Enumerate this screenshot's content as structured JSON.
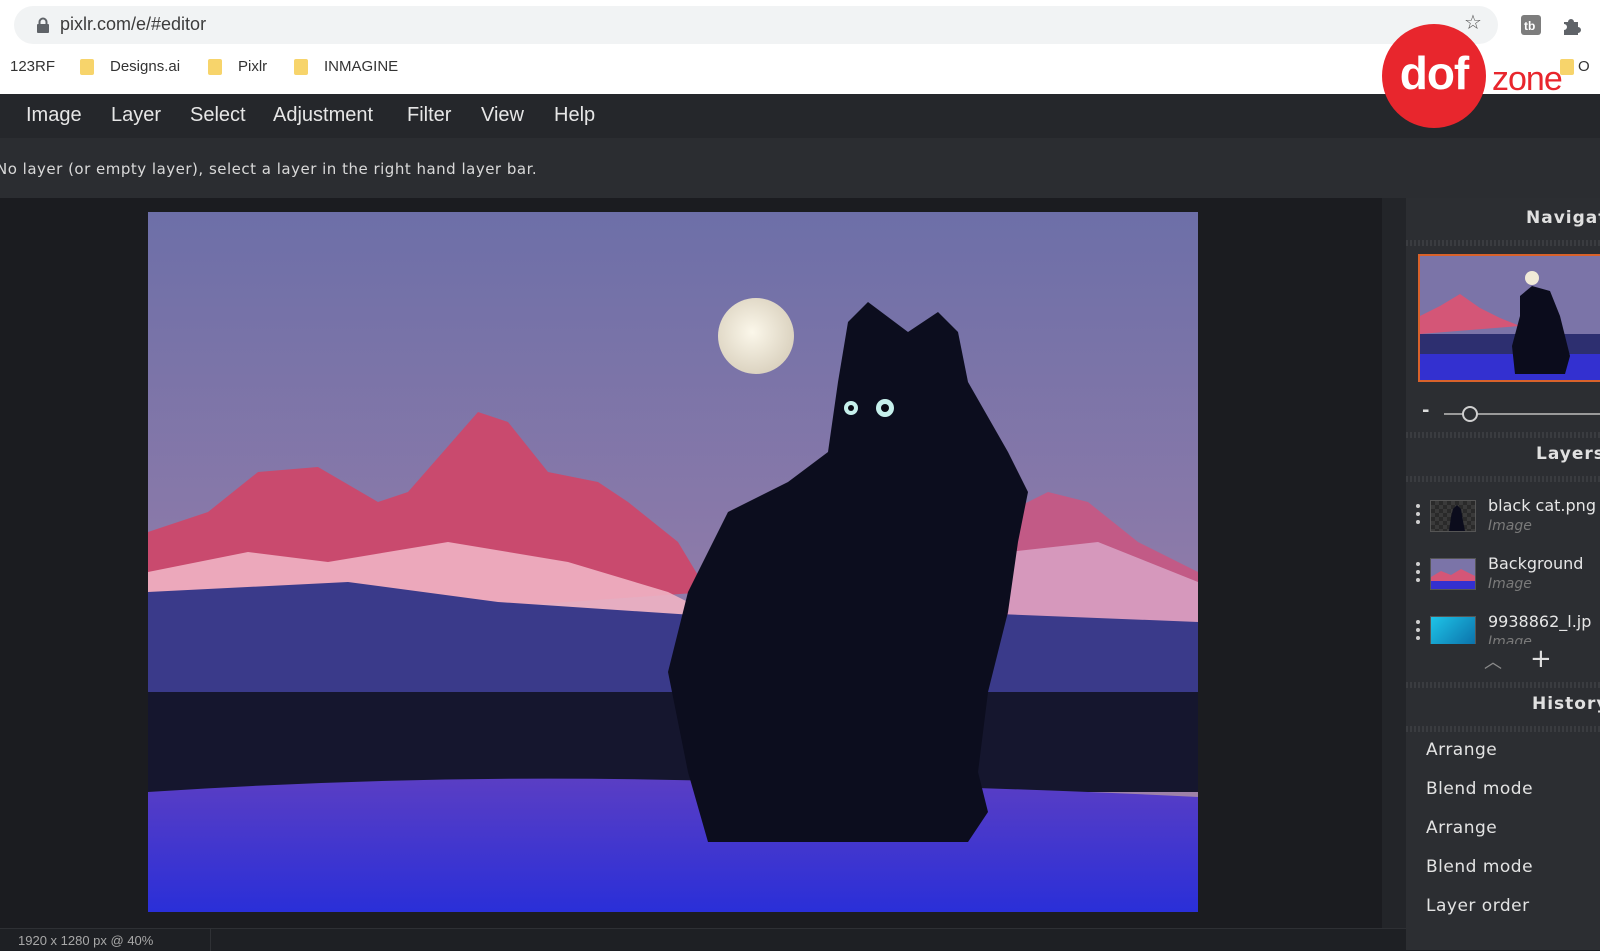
{
  "browser": {
    "url": "pixlr.com/e/#editor",
    "bookmarks": [
      "123RF",
      "Designs.ai",
      "Pixlr",
      "INMAGINE",
      "O"
    ]
  },
  "watermark": {
    "circle_text": "dof",
    "side_text": "zone",
    "color": "#e8262d"
  },
  "menu": {
    "items": [
      "Image",
      "Layer",
      "Select",
      "Adjustment",
      "Filter",
      "View",
      "Help"
    ]
  },
  "infobar": {
    "message": "No layer (or empty layer), select a layer in the right hand layer bar."
  },
  "status": {
    "text": "1920 x 1280 px @ 40%"
  },
  "panel": {
    "navigator_title": "Navigat",
    "zoom_minus": "-",
    "layers_title": "Layers",
    "layers": [
      {
        "name": "black cat.png",
        "type": "Image"
      },
      {
        "name": "Background",
        "type": "Image"
      },
      {
        "name": "9938862_l.jp",
        "type": "Image"
      }
    ],
    "history_title": "History",
    "history": [
      "Arrange",
      "Blend mode",
      "Arrange",
      "Blend mode",
      "Layer order"
    ]
  },
  "colors": {
    "accent": "#d9622b",
    "menubar_bg": "#25272b",
    "panel_bg": "#2c2e32"
  }
}
